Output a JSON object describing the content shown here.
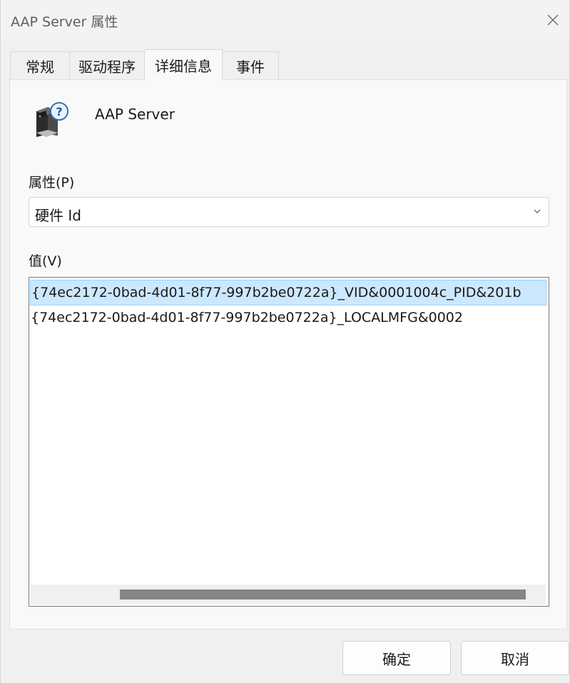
{
  "window": {
    "title": "AAP Server 属性"
  },
  "tabs": [
    {
      "label": "常规"
    },
    {
      "label": "驱动程序"
    },
    {
      "label": "详细信息"
    },
    {
      "label": "事件"
    }
  ],
  "active_tab_index": 2,
  "device": {
    "name": "AAP Server",
    "icon": "unknown-device-icon"
  },
  "property": {
    "label": "属性(P)",
    "selected": "硬件 Id"
  },
  "value": {
    "label": "值(V)",
    "items": [
      "{74ec2172-0bad-4d01-8f77-997b2be0722a}_VID&0001004c_PID&201b",
      "{74ec2172-0bad-4d01-8f77-997b2be0722a}_LOCALMFG&0002"
    ]
  },
  "buttons": {
    "ok": "确定",
    "cancel": "取消"
  },
  "colors": {
    "selection": "#cce8ff",
    "selection_border": "#99d1ff"
  }
}
